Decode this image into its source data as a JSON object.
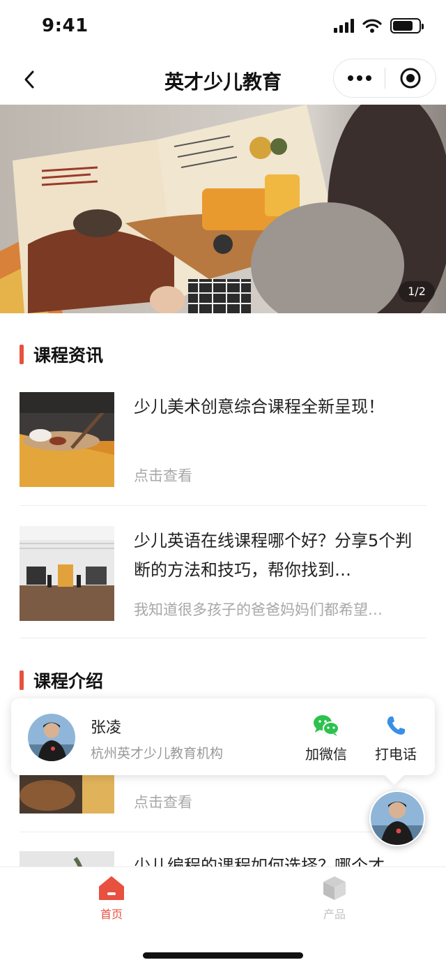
{
  "status_bar": {
    "time": "9:41"
  },
  "nav": {
    "title": "英才少儿教育"
  },
  "banner": {
    "counter": "1/2"
  },
  "sections": {
    "news": {
      "title": "课程资讯"
    },
    "intro": {
      "title": "课程介绍"
    }
  },
  "articles": [
    {
      "title": "少儿美术创意综合课程全新呈现！",
      "subtitle": "点击查看"
    },
    {
      "title": "少儿英语在线课程哪个好？分享5个判断的方法和技巧，帮你找到…",
      "subtitle": "我知道很多孩子的爸爸妈妈们都希望…"
    },
    {
      "title": "",
      "subtitle": "点击查看"
    },
    {
      "title": "少儿编程的课程如何选择？哪个才…",
      "subtitle": ""
    }
  ],
  "contact": {
    "name": "张凌",
    "org": "杭州英才少儿教育机构",
    "wechat_label": "加微信",
    "call_label": "打电话"
  },
  "tabs": [
    {
      "label": "首页",
      "icon": "home-icon",
      "active": true
    },
    {
      "label": "产品",
      "icon": "cube-icon",
      "active": false
    }
  ],
  "colors": {
    "accent": "#e8503f",
    "wechat": "#2dc14e",
    "phone": "#3a8ee6",
    "inactive": "#c2c2c2"
  }
}
